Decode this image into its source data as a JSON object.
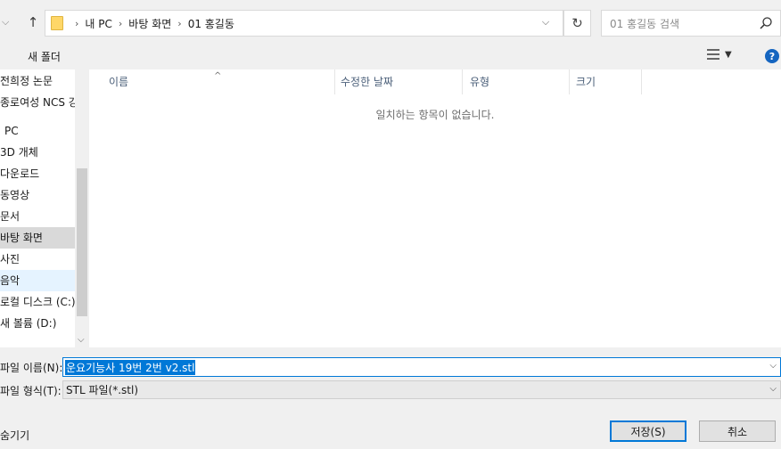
{
  "address": {
    "breadcrumbs": [
      "내 PC",
      "바탕 화면",
      "01 홍길동"
    ],
    "search_placeholder": "01 홍길동 검색"
  },
  "toolbar": {
    "new_folder_label": "새 폴더"
  },
  "nav_pane": {
    "items": [
      "전희정 논문",
      "종로여성 NCS 강",
      "PC",
      "3D 개체",
      "다운로드",
      "동영상",
      "문서",
      "바탕 화면",
      "사진",
      "음악",
      "로컬 디스크 (C:)",
      "새 볼륨 (D:)"
    ],
    "selected": "바탕 화면"
  },
  "file_list": {
    "columns": [
      "이름",
      "수정한 날짜",
      "유형",
      "크기"
    ],
    "empty_message": "일치하는 항목이 없습니다."
  },
  "form": {
    "filename_label": "파일 이름(N):",
    "filename_value": "운요기능사 19번 2번 v2.stl",
    "filetype_label": "파일 형식(T):",
    "filetype_value": "STL 파일(*.stl)"
  },
  "footer": {
    "hide_folders_label": "숨기기",
    "save_label": "저장(S)",
    "cancel_label": "취소"
  },
  "colors": {
    "accent": "#0078d7",
    "selected_bg": "#d9d9d9",
    "hover_bg": "#e5f3ff"
  }
}
